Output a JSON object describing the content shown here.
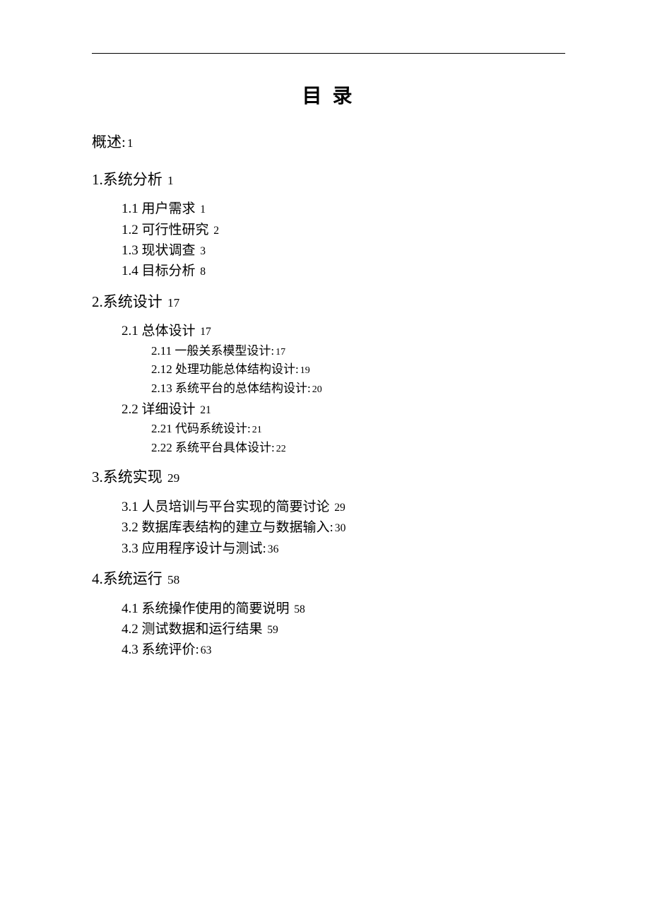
{
  "title": "目 录",
  "overview": {
    "label": "概述:",
    "page": "1"
  },
  "sections": [
    {
      "num": "1.",
      "label": "系统分析",
      "page": "1",
      "subs": [
        {
          "num": "1.1",
          "label": "用户需求",
          "page": "1"
        },
        {
          "num": "1.2",
          "label": "可行性研究",
          "page": "2"
        },
        {
          "num": "1.3",
          "label": "现状调查",
          "page": "3"
        },
        {
          "num": "1.4",
          "label": "目标分析",
          "page": "8"
        }
      ]
    },
    {
      "num": "2.",
      "label": "系统设计",
      "page": "17",
      "subs": [
        {
          "num": "2.1",
          "label": "总体设计",
          "page": "17",
          "subs": [
            {
              "num": "2.11",
              "label": "一般关系模型设计:",
              "page": "17"
            },
            {
              "num": "2.12",
              "label": "处理功能总体结构设计:",
              "page": "19"
            },
            {
              "num": "2.13",
              "label": "系统平台的总体结构设计:",
              "page": "20"
            }
          ]
        },
        {
          "num": "2.2",
          "label": "详细设计",
          "page": "21",
          "subs": [
            {
              "num": "2.21",
              "label": "代码系统设计:",
              "page": "21"
            },
            {
              "num": "2.22",
              "label": "系统平台具体设计:",
              "page": "22"
            }
          ]
        }
      ]
    },
    {
      "num": "3.",
      "label": "系统实现",
      "page": "29",
      "subs": [
        {
          "num": "3.1",
          "label": "人员培训与平台实现的简要讨论",
          "page": "29"
        },
        {
          "num": "3.2",
          "label": "数据库表结构的建立与数据输入:",
          "page": "30"
        },
        {
          "num": "3.3",
          "label": "应用程序设计与测试:",
          "page": "36"
        }
      ]
    },
    {
      "num": "4.",
      "label": "系统运行",
      "page": "58",
      "subs": [
        {
          "num": "4.1",
          "label": "系统操作使用的简要说明",
          "page": "58"
        },
        {
          "num": "4.2",
          "label": "测试数据和运行结果",
          "page": "59"
        },
        {
          "num": "4.3",
          "label": "系统评价:",
          "page": "63"
        }
      ]
    }
  ]
}
